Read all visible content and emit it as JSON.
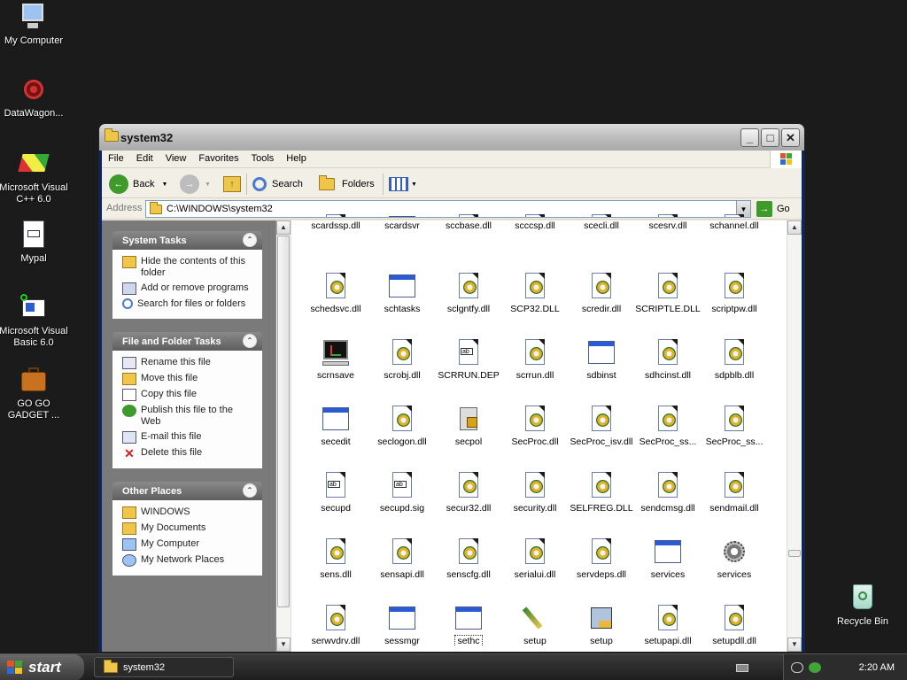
{
  "desktop": {
    "icons": [
      {
        "label": "My Computer",
        "icon": "my-computer-icon"
      },
      {
        "label": "DataWagon...",
        "icon": "datawagon-icon"
      },
      {
        "label": "Microsoft Visual C++ 6.0",
        "icon": "visual-cpp-icon"
      },
      {
        "label": "Mypal",
        "icon": "mypal-icon"
      },
      {
        "label": "Microsoft Visual Basic 6.0",
        "icon": "visual-basic-icon"
      },
      {
        "label": "GO GO GADGET ...",
        "icon": "briefcase-icon"
      },
      {
        "label": "Recycle Bin",
        "icon": "recycle-bin-icon"
      }
    ]
  },
  "window": {
    "title": "system32",
    "menu": [
      "File",
      "Edit",
      "View",
      "Favorites",
      "Tools",
      "Help"
    ],
    "toolbar": {
      "back": "Back",
      "search": "Search",
      "folders": "Folders"
    },
    "address": {
      "label": "Address",
      "value": "C:\\WINDOWS\\system32",
      "go": "Go"
    }
  },
  "taskpane": {
    "system_tasks": {
      "title": "System Tasks",
      "items": [
        "Hide the contents of this folder",
        "Add or remove programs",
        "Search for files or folders"
      ]
    },
    "file_tasks": {
      "title": "File and Folder Tasks",
      "items": [
        "Rename this file",
        "Move this file",
        "Copy this file",
        "Publish this file to the Web",
        "E-mail this file",
        "Delete this file"
      ]
    },
    "other_places": {
      "title": "Other Places",
      "items": [
        "WINDOWS",
        "My Documents",
        "My Computer",
        "My Network Places"
      ]
    }
  },
  "files": {
    "row0": [
      "scardssp.dll",
      "scardsvr",
      "sccbase.dll",
      "scccsp.dll",
      "scecli.dll",
      "scesrv.dll",
      "schannel.dll"
    ],
    "row1": [
      "schedsvc.dll",
      "schtasks",
      "sclgntfy.dll",
      "SCP32.DLL",
      "scredir.dll",
      "SCRIPTLE.DLL",
      "scriptpw.dll"
    ],
    "row2": [
      "scrnsave",
      "scrobj.dll",
      "SCRRUN.DEP",
      "scrrun.dll",
      "sdbinst",
      "sdhcinst.dll",
      "sdpblb.dll"
    ],
    "row3": [
      "secedit",
      "seclogon.dll",
      "secpol",
      "SecProc.dll",
      "SecProc_isv.dll",
      "SecProc_ss...",
      "SecProc_ss..."
    ],
    "row4": [
      "secupd",
      "secupd.sig",
      "secur32.dll",
      "security.dll",
      "SELFREG.DLL",
      "sendcmsg.dll",
      "sendmail.dll"
    ],
    "row5": [
      "sens.dll",
      "sensapi.dll",
      "senscfg.dll",
      "serialui.dll",
      "servdeps.dll",
      "services",
      "services"
    ],
    "row6": [
      "serwvdrv.dll",
      "sessmgr",
      "sethc",
      "setup",
      "setup",
      "setupapi.dll",
      "setupdll.dll"
    ]
  },
  "taskbar": {
    "start": "start",
    "active_window": "system32",
    "clock": "2:20 AM"
  }
}
